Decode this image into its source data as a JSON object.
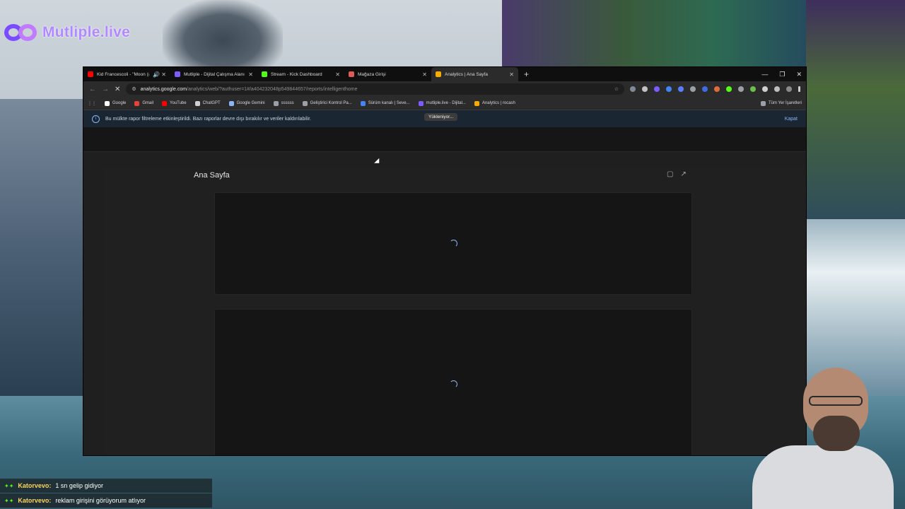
{
  "overlay": {
    "logo_text": "Mutliple.live",
    "chat": [
      {
        "user": "Katorvevo:",
        "message": "1 sn gelip gidiyor"
      },
      {
        "user": "Katorvevo:",
        "message": "reklam girişini görüyorum atlıyor"
      }
    ]
  },
  "browser": {
    "tabs": [
      {
        "title": "Kid Francescoli - \"Moon (a",
        "favicon_color": "#ff0000",
        "active": false
      },
      {
        "title": "Mutliple - Dijital Çalışma Alanı",
        "favicon_color": "#7c5cff",
        "active": false
      },
      {
        "title": "Stream - Kick Dashboard",
        "favicon_color": "#53fc18",
        "active": false
      },
      {
        "title": "Mağaza Girişi",
        "favicon_color": "#e05a5a",
        "active": false
      },
      {
        "title": "Analytics | Ana Sayfa",
        "favicon_color": "#f9ab00",
        "active": true
      }
    ],
    "url_host": "analytics.google.com",
    "url_path": "/analytics/web/?authuser=1#/a404232048p549844657/reports/intelligenthome",
    "bookmarks": [
      {
        "label": "Google",
        "color": "#ffffff"
      },
      {
        "label": "Gmail",
        "color": "#ea4335"
      },
      {
        "label": "YouTube",
        "color": "#ff0000"
      },
      {
        "label": "ChatGPT",
        "color": "#d0d0d0"
      },
      {
        "label": "Google Gemini",
        "color": "#8ab4f8"
      },
      {
        "label": "ssssss",
        "color": "#9aa0a6"
      },
      {
        "label": "Geliştirici Kontrol Pa...",
        "color": "#9aa0a6"
      },
      {
        "label": "Sürüm kanalı | Seve...",
        "color": "#4285f4"
      },
      {
        "label": "mutliple.live - Dijital...",
        "color": "#7c5cff"
      },
      {
        "label": "Analytics | rocash",
        "color": "#f9ab00"
      }
    ],
    "all_bookmarks": "Tüm Yer İşaretleri"
  },
  "page": {
    "banner_text": "Bu mülkte rapor filtreleme etkinleştirildi. Bazı raporlar devre dışı bırakılır ve veriler kaldırılabilir.",
    "loading_label": "Yükleniyor...",
    "banner_close": "Kapat",
    "title": "Ana Sayfa"
  }
}
